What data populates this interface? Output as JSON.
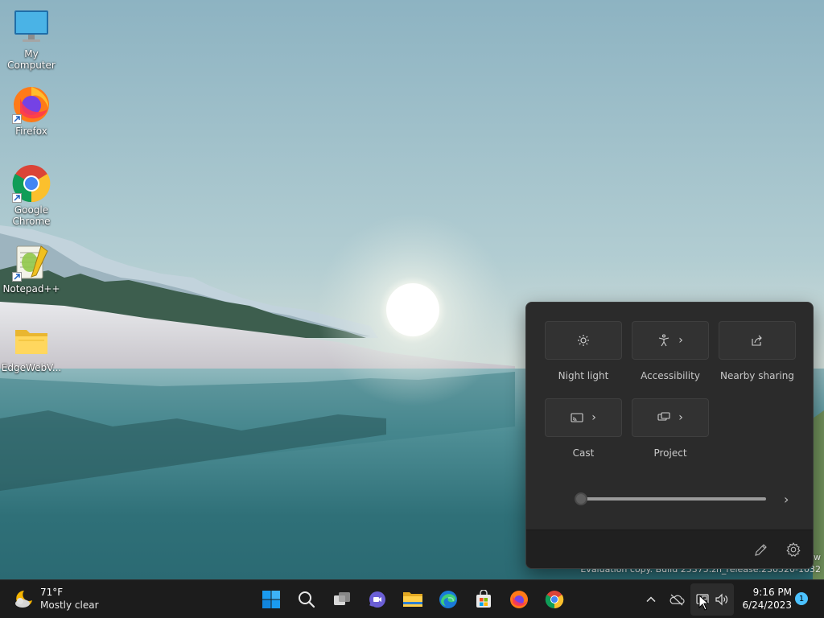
{
  "desktop": {
    "icons": [
      {
        "label": "My Computer",
        "icon": "monitor-icon"
      },
      {
        "label": "Firefox",
        "icon": "firefox-icon"
      },
      {
        "label": "Google Chrome",
        "icon": "chrome-icon"
      },
      {
        "label": "Notepad++",
        "icon": "notepadpp-icon"
      },
      {
        "label": "EdgeWebV...",
        "icon": "folder-icon"
      }
    ],
    "watermark": {
      "line1": "w",
      "line2": "Evaluation copy. Build 25375.zn_release.230520-1032"
    }
  },
  "quick_settings": {
    "tiles": [
      {
        "label": "Night light",
        "icon": "brightness-icon",
        "chevron": false
      },
      {
        "label": "Accessibility",
        "icon": "accessibility-icon",
        "chevron": true
      },
      {
        "label": "Nearby sharing",
        "icon": "share-icon",
        "chevron": false
      },
      {
        "label": "Cast",
        "icon": "cast-icon",
        "chevron": true
      },
      {
        "label": "Project",
        "icon": "project-icon",
        "chevron": true
      }
    ],
    "brightness_value": 0,
    "footer": {
      "edit_icon": "pencil-icon",
      "settings_icon": "gear-icon"
    }
  },
  "taskbar": {
    "weather": {
      "temp": "71°F",
      "desc": "Mostly clear"
    },
    "apps": [
      "start-icon",
      "search-icon",
      "task-view-icon",
      "chat-icon",
      "file-explorer-icon",
      "edge-icon",
      "store-icon",
      "firefox-icon",
      "chrome-icon"
    ],
    "tray": [
      "chevron-up-icon",
      "onedrive-icon",
      "network-icon",
      "volume-icon"
    ],
    "clock": {
      "time": "9:16 PM",
      "date": "6/24/2023"
    },
    "notification_count": "1"
  },
  "colors": {
    "flyout_bg": "#2b2b2b",
    "taskbar_bg": "#1c1c1c",
    "accent": "#4cc2ff"
  }
}
